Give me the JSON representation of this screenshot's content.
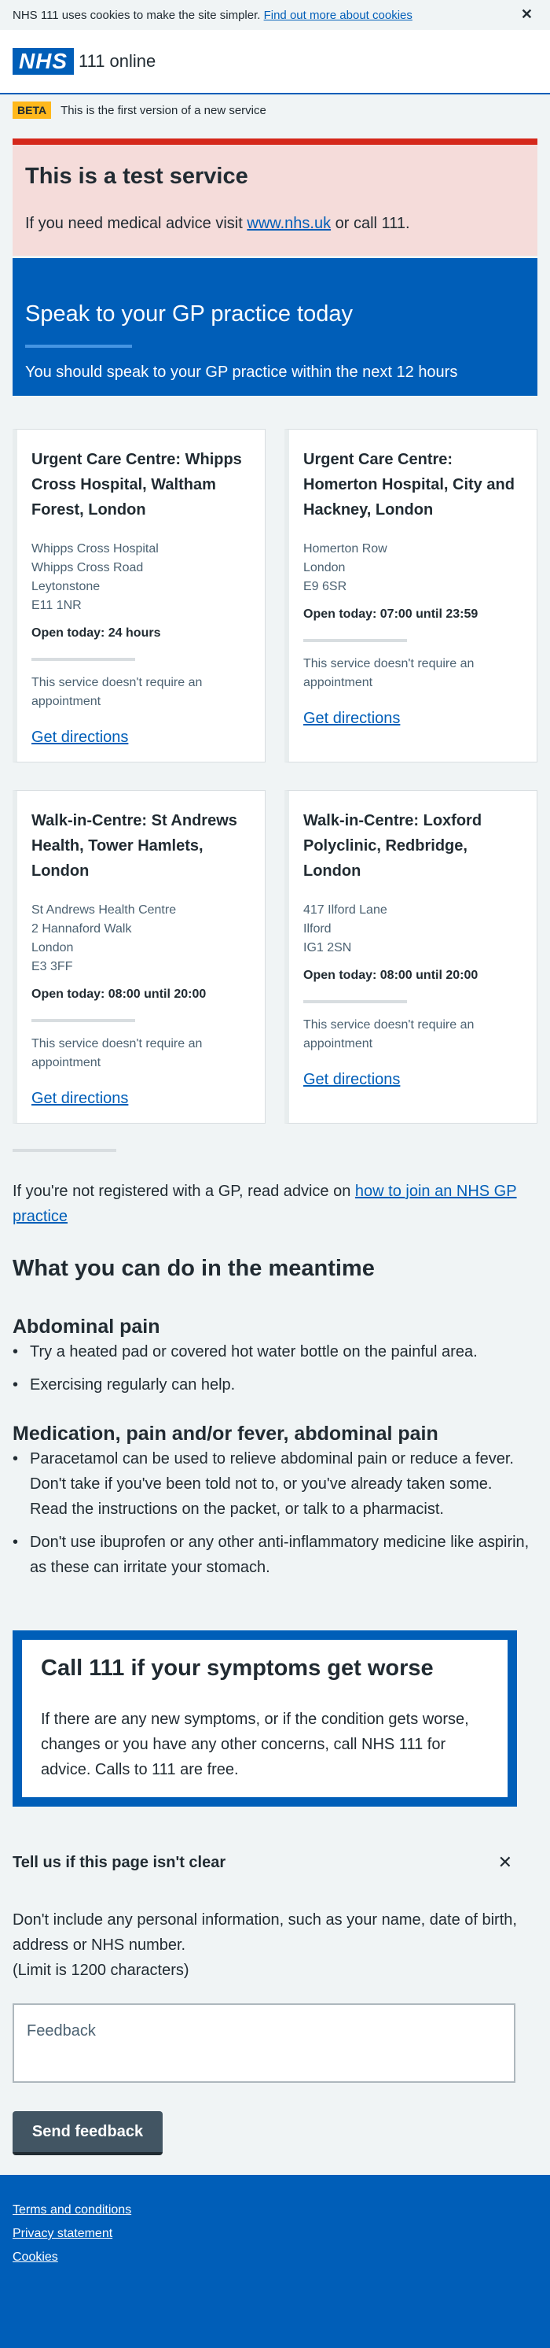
{
  "cookie_banner": {
    "text": "NHS 111 uses cookies to make the site simpler.",
    "link": "Find out more about cookies",
    "close": "✕"
  },
  "header": {
    "logo": "NHS",
    "site_name": "111 online"
  },
  "beta": {
    "tag": "BETA",
    "text": "This is the first version of a new service"
  },
  "test_panel": {
    "title": "This is a test service",
    "text_before": "If you need medical advice visit ",
    "link": "www.nhs.uk",
    "text_after": " or call 111."
  },
  "gp_panel": {
    "title": "Speak to your GP practice today",
    "text": "You should speak to your GP practice within the next 12 hours"
  },
  "services": [
    {
      "name": "Urgent Care Centre: Whipps Cross Hospital, Waltham Forest, London",
      "address": [
        "Whipps Cross Hospital",
        "Whipps Cross Road",
        "Leytonstone",
        "E11 1NR"
      ],
      "open": "Open today: 24 hours",
      "appointment": "This service doesn't require an appointment",
      "directions": "Get directions"
    },
    {
      "name": "Urgent Care Centre: Homerton Hospital, City and Hackney, London",
      "address": [
        "Homerton Row",
        "London",
        "E9 6SR"
      ],
      "open": "Open today: 07:00 until 23:59",
      "appointment": "This service doesn't require an appointment",
      "directions": "Get directions"
    },
    {
      "name": "Walk-in-Centre: St Andrews Health, Tower Hamlets, London",
      "address": [
        "St Andrews Health Centre",
        "2 Hannaford Walk",
        "London",
        "E3 3FF"
      ],
      "open": "Open today: 08:00 until 20:00",
      "appointment": "This service doesn't require an appointment",
      "directions": "Get directions"
    },
    {
      "name": "Walk-in-Centre: Loxford Polyclinic, Redbridge, London",
      "address": [
        "417 Ilford Lane",
        "Ilford",
        "IG1 2SN"
      ],
      "open": "Open today: 08:00 until 20:00",
      "appointment": "This service doesn't require an appointment",
      "directions": "Get directions"
    }
  ],
  "register": {
    "text_before": "If you're not registered with a GP, read advice on ",
    "link": "how to join an NHS GP practice"
  },
  "meantime": {
    "title": "What you can do in the meantime",
    "sections": [
      {
        "heading": "Abdominal pain",
        "items": [
          "Try a heated pad or covered hot water bottle on the painful area.",
          "Exercising regularly can help."
        ]
      },
      {
        "heading": "Medication, pain and/or fever, abdominal pain",
        "items": [
          "Paracetamol can be used to relieve abdominal pain or reduce a fever. Don't take if you've been told not to, or you've already taken some. Read the instructions on the packet, or talk to a pharmacist.",
          "Don't use ibuprofen or any other anti-inflammatory medicine like aspirin, as these can irritate your stomach."
        ]
      }
    ]
  },
  "call_111": {
    "title": "Call 111 if your symptoms get worse",
    "text": "If there are any new symptoms, or if the condition gets worse, changes or you have any other concerns, call NHS 111 for advice. Calls to 111 are free."
  },
  "feedback": {
    "title": "Tell us if this page isn't clear",
    "close": "✕",
    "help_line1": "Don't include any personal information, such as your name, date of birth, address or NHS number.",
    "help_line2": "(Limit is 1200 characters)",
    "placeholder": "Feedback",
    "button": "Send feedback"
  },
  "footer": {
    "links": [
      "Terms and conditions",
      "Privacy statement",
      "Cookies"
    ]
  }
}
